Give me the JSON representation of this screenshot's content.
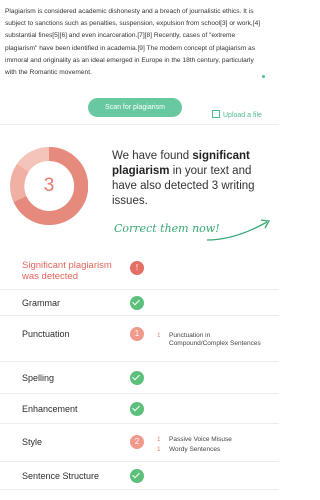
{
  "article": {
    "text": "Plagiarism is considered academic dishonesty and a breach of journalistic ethics. It is subject to sanctions such as penalties, suspension, expulsion from school[3] or work,[4] substantial fines[5][6] and even incarceration.[7][8] Recently, cases of \"extreme plagiarism\" have been identified in academia.[9] The modern concept of plagiarism as immoral and originality as an ideal emerged in Europe in the 18th century, particularly with the Romantic movement."
  },
  "actions": {
    "scan_label": "Scan for plagiarism",
    "upload_label": "Upload a file"
  },
  "summary": {
    "issue_count": "3",
    "headline_pre": "We have found",
    "headline_bold": "significant plagiarism",
    "headline_post": "in your text and have also detected 3 writing issues.",
    "cta": "Correct them now!"
  },
  "donut": {
    "colors": [
      "#e68a7d",
      "#f4c4bb",
      "#f1b0a4"
    ]
  },
  "results": [
    {
      "label": "Significant plagiarism was detected",
      "status": "!",
      "kind": "alert"
    },
    {
      "label": "Grammar",
      "status": "ok"
    },
    {
      "label": "Punctuation",
      "status": "1",
      "issues": [
        {
          "n": "1",
          "text": "Punctuation in Compound/Complex Sentences"
        }
      ]
    },
    {
      "label": "Spelling",
      "status": "ok"
    },
    {
      "label": "Enhancement",
      "status": "ok"
    },
    {
      "label": "Style",
      "status": "2",
      "issues": [
        {
          "n": "1",
          "text": "Passive Voice Misuse"
        },
        {
          "n": "1",
          "text": "Wordy Sentences"
        }
      ]
    },
    {
      "label": "Sentence Structure",
      "status": "ok"
    }
  ],
  "colors": {
    "accent": "#4fb98a",
    "alert": "#e2655a"
  }
}
